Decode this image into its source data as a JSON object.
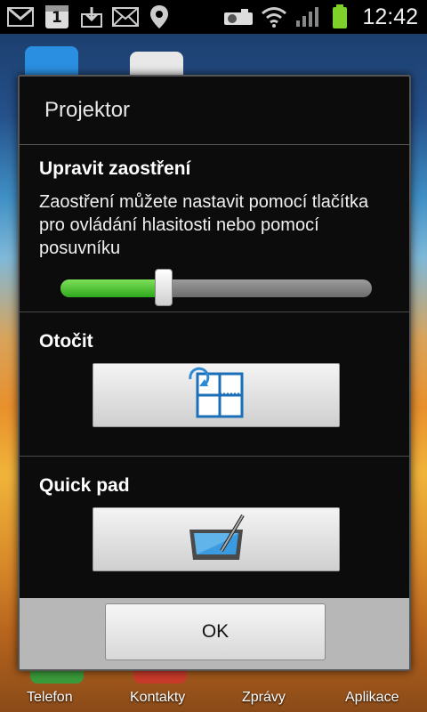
{
  "status_bar": {
    "time": "12:42",
    "calendar_day": "1",
    "icons": [
      "gmail-icon",
      "calendar-icon",
      "download-icon",
      "email-icon",
      "location-icon",
      "projector-icon",
      "wifi-icon",
      "signal-icon",
      "battery-icon"
    ]
  },
  "home": {
    "dock": [
      "Telefon",
      "Kontakty",
      "Zprávy",
      "Aplikace"
    ]
  },
  "dialog": {
    "title": "Projektor",
    "focus": {
      "heading": "Upravit zaostření",
      "description": "Zaostření můžete nastavit pomocí tlačítka pro ovládání hlasitosti nebo pomocí posuvníku",
      "slider_value": 0.33
    },
    "rotate": {
      "heading": "Otočit",
      "icon": "rotate-screen-icon"
    },
    "quick_pad": {
      "heading": "Quick pad",
      "icon": "tablet-pen-icon"
    },
    "ok_label": "OK"
  },
  "colors": {
    "slider_fill": "#3cb82a",
    "dialog_bg": "#0c0c0c",
    "footer_bg": "#b7b7b7"
  }
}
